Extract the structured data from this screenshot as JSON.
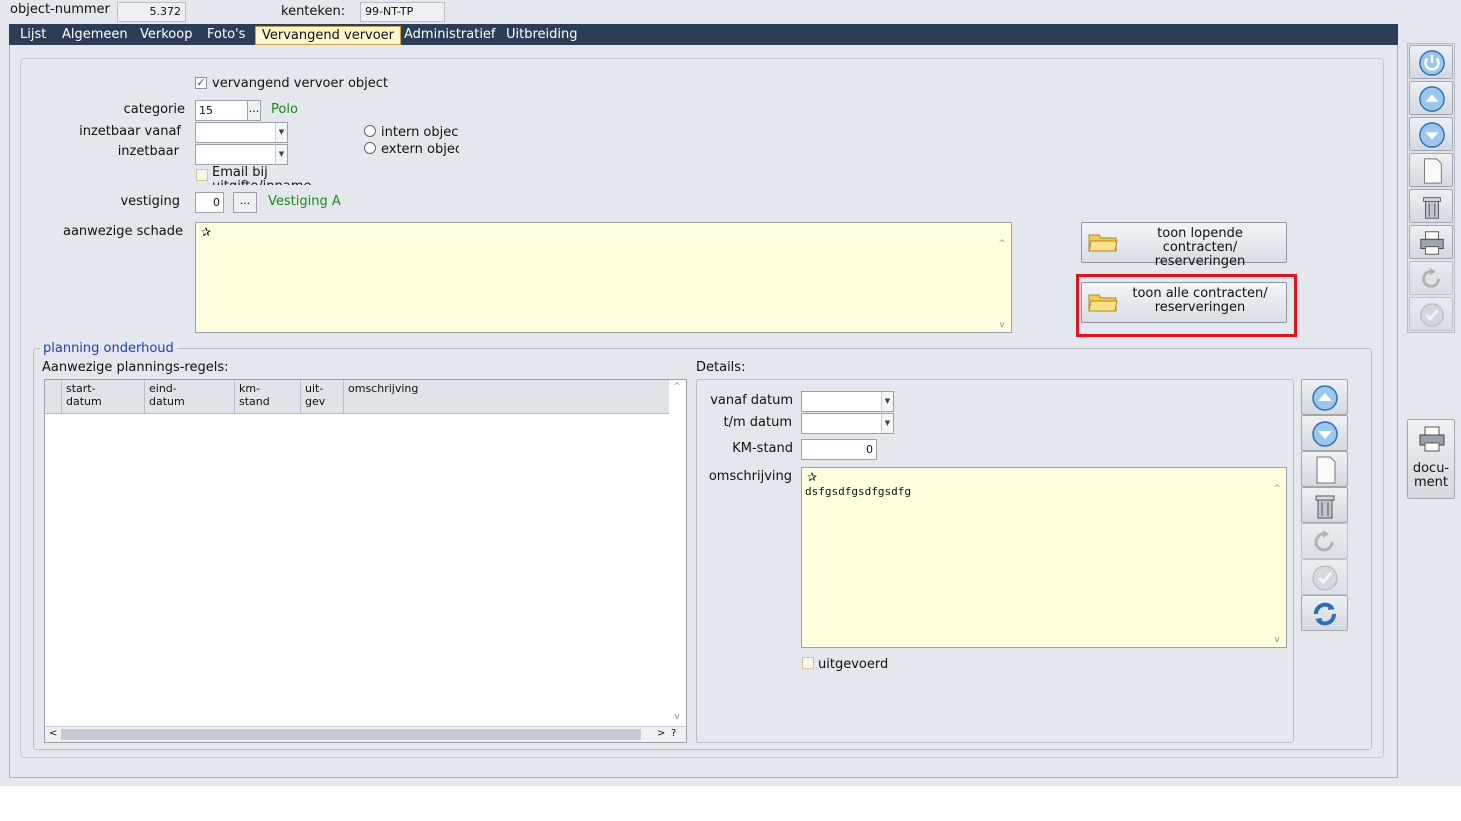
{
  "header": {
    "object_nummer_label": "object-nummer",
    "object_nummer_value": "5.372",
    "kenteken_label": "kenteken:",
    "kenteken_value": "99-NT-TP"
  },
  "tabs": [
    {
      "label": "Lijst"
    },
    {
      "label": "Algemeen"
    },
    {
      "label": "Verkoop"
    },
    {
      "label": "Foto's"
    },
    {
      "label": "Vervangend vervoer",
      "active": true
    },
    {
      "label": "Administratief"
    },
    {
      "label": "Uitbreiding"
    }
  ],
  "form": {
    "vervangend_checkbox_label": "vervangend vervoer object",
    "vervangend_checked": true,
    "categorie_label": "categorie",
    "categorie_value": "15",
    "categorie_button": "...",
    "categorie_name": "Polo",
    "inzetbaar_vanaf_label": "inzetbaar vanaf",
    "inzetbaar_vanaf_value": "",
    "inzetbaar_label": "inzetbaar",
    "inzetbaar_value": "",
    "intern_label": "intern object",
    "extern_label": "extern object",
    "email_label": "Email bij uitgifte/inname",
    "vestiging_label": "vestiging",
    "vestiging_value": "0",
    "vestiging_button": "...",
    "vestiging_name": "Vestiging A",
    "schade_label": "aanwezige schade",
    "schade_value": ""
  },
  "buttons": {
    "lopende_line1": "toon lopende contracten/",
    "lopende_line2": "reserveringen",
    "alle_line1": "toon alle contracten/",
    "alle_line2": "reserveringen"
  },
  "planning": {
    "group_title": "planning onderhoud",
    "regels_label": "Aanwezige plannings-regels:",
    "columns": [
      {
        "line1": "start-",
        "line2": "datum"
      },
      {
        "line1": "eind-",
        "line2": "datum"
      },
      {
        "line1": "km-",
        "line2": "stand"
      },
      {
        "line1": "uit-",
        "line2": "gev"
      },
      {
        "line1": "omschrijving",
        "line2": ""
      }
    ],
    "rows": [],
    "scroll_help": "?",
    "details_label": "Details:",
    "vanaf_datum_label": "vanaf datum",
    "vanaf_datum_value": "",
    "tm_datum_label": "t/m datum",
    "tm_datum_value": "",
    "km_stand_label": "KM-stand",
    "km_stand_value": "0",
    "omschrijving_label": "omschrijving",
    "omschrijving_value": "dsfgsdfgsdfgsdfg",
    "uitgevoerd_label": "uitgevoerd"
  },
  "side_toolbar": {
    "document_line1": "docu-",
    "document_line2": "ment"
  },
  "colors": {
    "tabbar": "#2c3e57",
    "memo_bg": "#ffffe0",
    "highlight": "#e0141e",
    "green_text": "#1a8a1a",
    "group_title": "#1b3fbf"
  }
}
